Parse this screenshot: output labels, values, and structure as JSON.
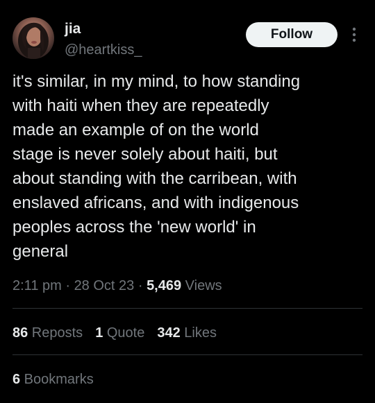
{
  "author": {
    "display_name": "jia",
    "handle": "@heartkiss_",
    "avatar_icon": "profile-photo"
  },
  "header": {
    "follow_label": "Follow",
    "more_icon": "vertical-ellipsis-icon"
  },
  "tweet": {
    "text": "it's similar, in my mind, to how standing\nwith haiti when they are repeatedly\nmade an example of on the world\nstage is never solely about haiti, but\nabout standing with the carribean, with\nenslaved africans, and with indigenous\npeoples across the 'new world' in\ngeneral"
  },
  "meta": {
    "time": "2:11 pm",
    "sep1": " · ",
    "date": "28 Oct 23",
    "sep2": " · ",
    "views_count": "5,469",
    "views_label": " Views"
  },
  "stats": {
    "reposts_count": "86",
    "reposts_label": " Reposts",
    "quotes_count": "1",
    "quotes_label": " Quote",
    "likes_count": "342",
    "likes_label": " Likes"
  },
  "bookmarks": {
    "count": "6",
    "label": " Bookmarks"
  },
  "colors": {
    "background": "#000000",
    "primary_text": "#e7e9ea",
    "secondary_text": "#71767b",
    "divider": "#2f3336",
    "follow_bg": "#eff3f4"
  }
}
